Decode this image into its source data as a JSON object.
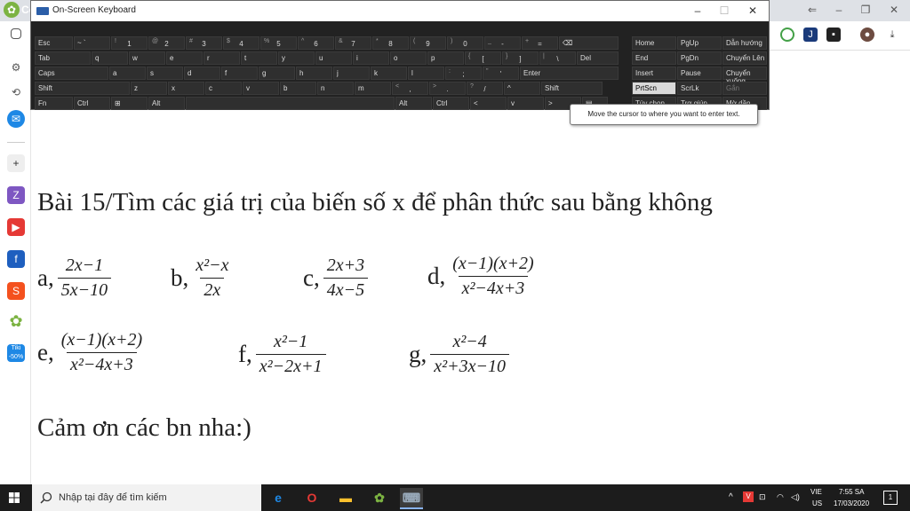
{
  "browser": {
    "brand_text": "Cc",
    "win_controls": [
      "–",
      "❐",
      "✕"
    ]
  },
  "osk": {
    "title": "On-Screen Keyboard",
    "controls": [
      "–",
      "☐",
      "✕"
    ],
    "rows": [
      [
        [
          "Esc",
          ""
        ],
        [
          "~ `",
          ""
        ],
        [
          "1",
          "!"
        ],
        [
          "2",
          "@"
        ],
        [
          "3",
          "#"
        ],
        [
          "4",
          "$"
        ],
        [
          "5",
          "%"
        ],
        [
          "6",
          "^"
        ],
        [
          "7",
          "&"
        ],
        [
          "8",
          "*"
        ],
        [
          "9",
          "("
        ],
        [
          "0",
          ")"
        ],
        [
          "-",
          "_"
        ],
        [
          "=",
          "+"
        ],
        [
          "⌫",
          ""
        ]
      ],
      [
        [
          "Tab",
          ""
        ],
        [
          "q",
          ""
        ],
        [
          "w",
          ""
        ],
        [
          "e",
          ""
        ],
        [
          "r",
          ""
        ],
        [
          "t",
          ""
        ],
        [
          "y",
          ""
        ],
        [
          "u",
          ""
        ],
        [
          "i",
          ""
        ],
        [
          "o",
          ""
        ],
        [
          "p",
          ""
        ],
        [
          "[",
          "{"
        ],
        [
          "]",
          "}"
        ],
        [
          "\\",
          "|"
        ],
        [
          "Del",
          ""
        ]
      ],
      [
        [
          "Caps",
          ""
        ],
        [
          "a",
          ""
        ],
        [
          "s",
          ""
        ],
        [
          "d",
          ""
        ],
        [
          "f",
          ""
        ],
        [
          "g",
          ""
        ],
        [
          "h",
          ""
        ],
        [
          "j",
          ""
        ],
        [
          "k",
          ""
        ],
        [
          "l",
          ""
        ],
        [
          ";",
          ":"
        ],
        [
          "'",
          "\""
        ],
        [
          "Enter",
          ""
        ]
      ],
      [
        [
          "Shift",
          ""
        ],
        [
          "z",
          ""
        ],
        [
          "x",
          ""
        ],
        [
          "c",
          ""
        ],
        [
          "v",
          ""
        ],
        [
          "b",
          ""
        ],
        [
          "n",
          ""
        ],
        [
          "m",
          ""
        ],
        [
          ",",
          "<"
        ],
        [
          ".",
          ">"
        ],
        [
          "/",
          "?"
        ],
        [
          "^",
          ""
        ],
        [
          "Shift",
          ""
        ]
      ],
      [
        [
          "Fn",
          ""
        ],
        [
          "Ctrl",
          ""
        ],
        [
          "⊞",
          ""
        ],
        [
          "Alt",
          ""
        ],
        [
          "",
          ""
        ],
        [
          "Alt",
          ""
        ],
        [
          "Ctrl",
          ""
        ],
        [
          "<",
          ""
        ],
        [
          "v",
          ""
        ],
        [
          ">",
          ""
        ],
        [
          "▤",
          ""
        ]
      ]
    ],
    "nav_keys": [
      [
        "Home",
        "PgUp",
        "Dẫn hướng"
      ],
      [
        "End",
        "PgDn",
        "Chuyển Lên"
      ],
      [
        "Insert",
        "Pause",
        "Chuyển xuống"
      ],
      [
        "PrtScn",
        "ScrLk",
        "Gắn"
      ],
      [
        "Tùy chọn",
        "Trợ giúp",
        "Mờ dần"
      ]
    ],
    "tooltip": "Move the cursor to where you want to enter text."
  },
  "content": {
    "heading": "Bài 15/Tìm các giá trị của biến số x để phân thức sau bằng không",
    "items": [
      {
        "label": "a,",
        "num": "2x−1",
        "den": "5x−10"
      },
      {
        "label": "b,",
        "num": "x²−x",
        "den": "2x"
      },
      {
        "label": "c,",
        "num": "2x+3",
        "den": "4x−5"
      },
      {
        "label": "d,",
        "num": "(x−1)(x+2)",
        "den": "x²−4x+3"
      },
      {
        "label": "e,",
        "num": "(x−1)(x+2)",
        "den": "x²−4x+3"
      },
      {
        "label": "f,",
        "num": "x²−1",
        "den": "x²−2x+1"
      },
      {
        "label": "g,",
        "num": "x²−4",
        "den": "x²+3x−10"
      }
    ],
    "thanks": "Cảm ơn các bn nha:)"
  },
  "sidebar": {
    "tiki_label": "Tiki -50%"
  },
  "taskbar": {
    "search_placeholder": "Nhập tại đây để tìm kiếm",
    "lang": "VIE",
    "lang_sub": "US",
    "time": "7:55 SA",
    "date": "17/03/2020",
    "notif_count": "1"
  }
}
